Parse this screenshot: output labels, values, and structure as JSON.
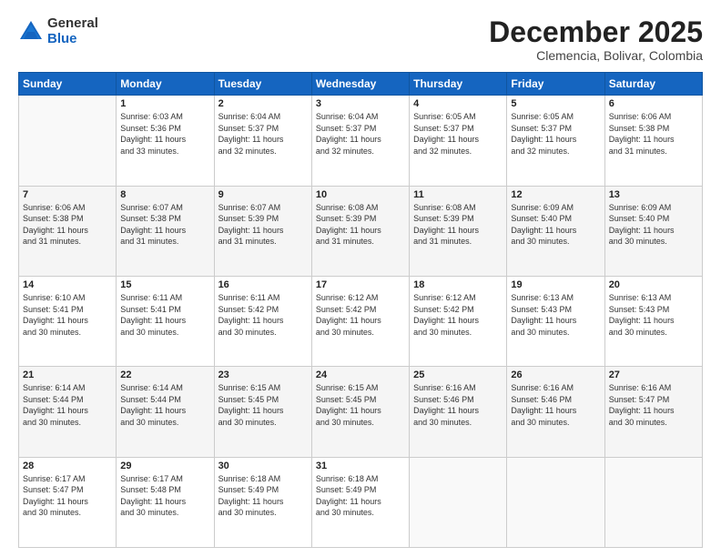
{
  "logo": {
    "general": "General",
    "blue": "Blue"
  },
  "title": "December 2025",
  "subtitle": "Clemencia, Bolivar, Colombia",
  "weekdays": [
    "Sunday",
    "Monday",
    "Tuesday",
    "Wednesday",
    "Thursday",
    "Friday",
    "Saturday"
  ],
  "weeks": [
    [
      {
        "day": "",
        "info": ""
      },
      {
        "day": "1",
        "info": "Sunrise: 6:03 AM\nSunset: 5:36 PM\nDaylight: 11 hours\nand 33 minutes."
      },
      {
        "day": "2",
        "info": "Sunrise: 6:04 AM\nSunset: 5:37 PM\nDaylight: 11 hours\nand 32 minutes."
      },
      {
        "day": "3",
        "info": "Sunrise: 6:04 AM\nSunset: 5:37 PM\nDaylight: 11 hours\nand 32 minutes."
      },
      {
        "day": "4",
        "info": "Sunrise: 6:05 AM\nSunset: 5:37 PM\nDaylight: 11 hours\nand 32 minutes."
      },
      {
        "day": "5",
        "info": "Sunrise: 6:05 AM\nSunset: 5:37 PM\nDaylight: 11 hours\nand 32 minutes."
      },
      {
        "day": "6",
        "info": "Sunrise: 6:06 AM\nSunset: 5:38 PM\nDaylight: 11 hours\nand 31 minutes."
      }
    ],
    [
      {
        "day": "7",
        "info": "Sunrise: 6:06 AM\nSunset: 5:38 PM\nDaylight: 11 hours\nand 31 minutes."
      },
      {
        "day": "8",
        "info": "Sunrise: 6:07 AM\nSunset: 5:38 PM\nDaylight: 11 hours\nand 31 minutes."
      },
      {
        "day": "9",
        "info": "Sunrise: 6:07 AM\nSunset: 5:39 PM\nDaylight: 11 hours\nand 31 minutes."
      },
      {
        "day": "10",
        "info": "Sunrise: 6:08 AM\nSunset: 5:39 PM\nDaylight: 11 hours\nand 31 minutes."
      },
      {
        "day": "11",
        "info": "Sunrise: 6:08 AM\nSunset: 5:39 PM\nDaylight: 11 hours\nand 31 minutes."
      },
      {
        "day": "12",
        "info": "Sunrise: 6:09 AM\nSunset: 5:40 PM\nDaylight: 11 hours\nand 30 minutes."
      },
      {
        "day": "13",
        "info": "Sunrise: 6:09 AM\nSunset: 5:40 PM\nDaylight: 11 hours\nand 30 minutes."
      }
    ],
    [
      {
        "day": "14",
        "info": "Sunrise: 6:10 AM\nSunset: 5:41 PM\nDaylight: 11 hours\nand 30 minutes."
      },
      {
        "day": "15",
        "info": "Sunrise: 6:11 AM\nSunset: 5:41 PM\nDaylight: 11 hours\nand 30 minutes."
      },
      {
        "day": "16",
        "info": "Sunrise: 6:11 AM\nSunset: 5:42 PM\nDaylight: 11 hours\nand 30 minutes."
      },
      {
        "day": "17",
        "info": "Sunrise: 6:12 AM\nSunset: 5:42 PM\nDaylight: 11 hours\nand 30 minutes."
      },
      {
        "day": "18",
        "info": "Sunrise: 6:12 AM\nSunset: 5:42 PM\nDaylight: 11 hours\nand 30 minutes."
      },
      {
        "day": "19",
        "info": "Sunrise: 6:13 AM\nSunset: 5:43 PM\nDaylight: 11 hours\nand 30 minutes."
      },
      {
        "day": "20",
        "info": "Sunrise: 6:13 AM\nSunset: 5:43 PM\nDaylight: 11 hours\nand 30 minutes."
      }
    ],
    [
      {
        "day": "21",
        "info": "Sunrise: 6:14 AM\nSunset: 5:44 PM\nDaylight: 11 hours\nand 30 minutes."
      },
      {
        "day": "22",
        "info": "Sunrise: 6:14 AM\nSunset: 5:44 PM\nDaylight: 11 hours\nand 30 minutes."
      },
      {
        "day": "23",
        "info": "Sunrise: 6:15 AM\nSunset: 5:45 PM\nDaylight: 11 hours\nand 30 minutes."
      },
      {
        "day": "24",
        "info": "Sunrise: 6:15 AM\nSunset: 5:45 PM\nDaylight: 11 hours\nand 30 minutes."
      },
      {
        "day": "25",
        "info": "Sunrise: 6:16 AM\nSunset: 5:46 PM\nDaylight: 11 hours\nand 30 minutes."
      },
      {
        "day": "26",
        "info": "Sunrise: 6:16 AM\nSunset: 5:46 PM\nDaylight: 11 hours\nand 30 minutes."
      },
      {
        "day": "27",
        "info": "Sunrise: 6:16 AM\nSunset: 5:47 PM\nDaylight: 11 hours\nand 30 minutes."
      }
    ],
    [
      {
        "day": "28",
        "info": "Sunrise: 6:17 AM\nSunset: 5:47 PM\nDaylight: 11 hours\nand 30 minutes."
      },
      {
        "day": "29",
        "info": "Sunrise: 6:17 AM\nSunset: 5:48 PM\nDaylight: 11 hours\nand 30 minutes."
      },
      {
        "day": "30",
        "info": "Sunrise: 6:18 AM\nSunset: 5:49 PM\nDaylight: 11 hours\nand 30 minutes."
      },
      {
        "day": "31",
        "info": "Sunrise: 6:18 AM\nSunset: 5:49 PM\nDaylight: 11 hours\nand 30 minutes."
      },
      {
        "day": "",
        "info": ""
      },
      {
        "day": "",
        "info": ""
      },
      {
        "day": "",
        "info": ""
      }
    ]
  ]
}
